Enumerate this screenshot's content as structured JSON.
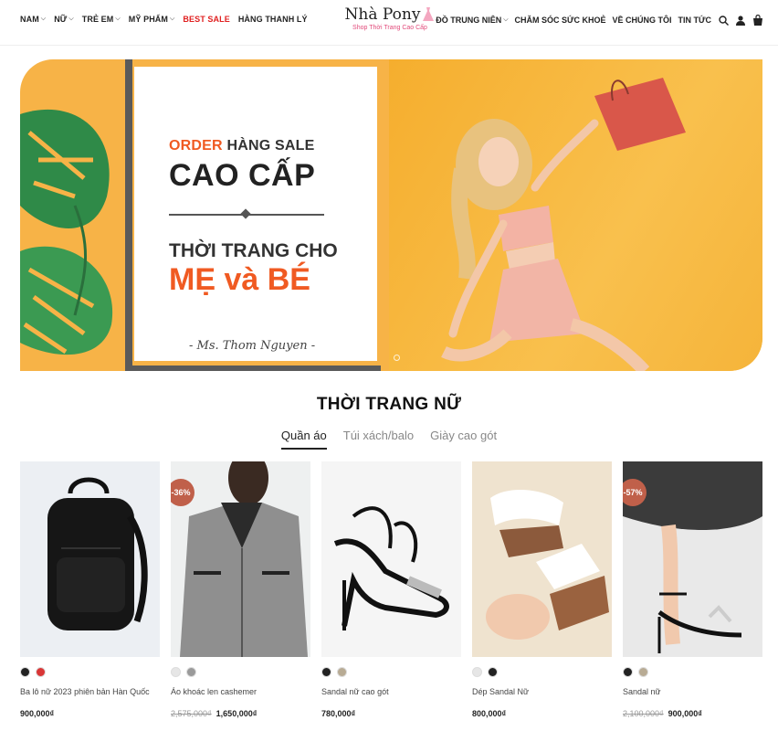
{
  "header": {
    "left_nav": [
      {
        "label": "NAM",
        "has_dropdown": true
      },
      {
        "label": "NỮ",
        "has_dropdown": true
      },
      {
        "label": "TRẺ EM",
        "has_dropdown": true
      },
      {
        "label": "MỸ PHẨM",
        "has_dropdown": true
      },
      {
        "label": "BEST SALE",
        "has_dropdown": false,
        "highlight": "#e02020"
      },
      {
        "label": "HÀNG THANH LÝ",
        "has_dropdown": false
      }
    ],
    "logo": {
      "name": "Nhà Pony",
      "tagline": "Shop Thời Trang Cao Cấp"
    },
    "right_nav": [
      {
        "label": "ĐỒ TRUNG NIÊN",
        "has_dropdown": true
      },
      {
        "label": "CHĂM SÓC SỨC KHOẺ",
        "has_dropdown": false
      },
      {
        "label": "VỀ CHÚNG TÔI",
        "has_dropdown": false
      },
      {
        "label": "TIN TỨC",
        "has_dropdown": false
      }
    ],
    "icons": [
      "search-icon",
      "user-icon",
      "cart-icon"
    ]
  },
  "hero": {
    "line1_accent": "ORDER",
    "line1_rest": "HÀNG SALE",
    "line2": "CAO CẤP",
    "line3": "THỜI TRANG CHO",
    "line4": "MẸ và BÉ",
    "signature": "- Ms. Thom Nguyen -",
    "accent_color": "#f05a22",
    "background_color": "#f7b347"
  },
  "section": {
    "title": "THỜI TRANG NỮ",
    "tabs": [
      {
        "label": "Quần áo",
        "active": true
      },
      {
        "label": "Túi xách/balo",
        "active": false
      },
      {
        "label": "Giày cao gót",
        "active": false
      }
    ]
  },
  "products": [
    {
      "name": "Ba lô nữ 2023 phiên bản Hàn Quốc",
      "old_price": "",
      "price": "900,000₫",
      "badge": "",
      "swatches": [
        "#222222",
        "#d93636"
      ],
      "image": "backpack"
    },
    {
      "name": "Áo khoác len cashemer",
      "old_price": "2,575,000₫",
      "price": "1,650,000₫",
      "badge": "-36%",
      "swatches": [
        "#e6e6e6",
        "#9a9a9a"
      ],
      "image": "jacket"
    },
    {
      "name": "Sandal nữ cao gót",
      "old_price": "",
      "price": "780,000₫",
      "badge": "",
      "swatches": [
        "#222222",
        "#b8ab94"
      ],
      "image": "sandal-heel"
    },
    {
      "name": "Dép Sandal Nữ",
      "old_price": "",
      "price": "800,000₫",
      "badge": "",
      "swatches": [
        "#e6e6e6",
        "#222222"
      ],
      "image": "slide-sandal"
    },
    {
      "name": "Sandal nữ",
      "old_price": "2,100,000₫",
      "price": "900,000₫",
      "badge": "-57%",
      "swatches": [
        "#222222",
        "#b8ab94"
      ],
      "image": "ankle-sandal"
    }
  ]
}
